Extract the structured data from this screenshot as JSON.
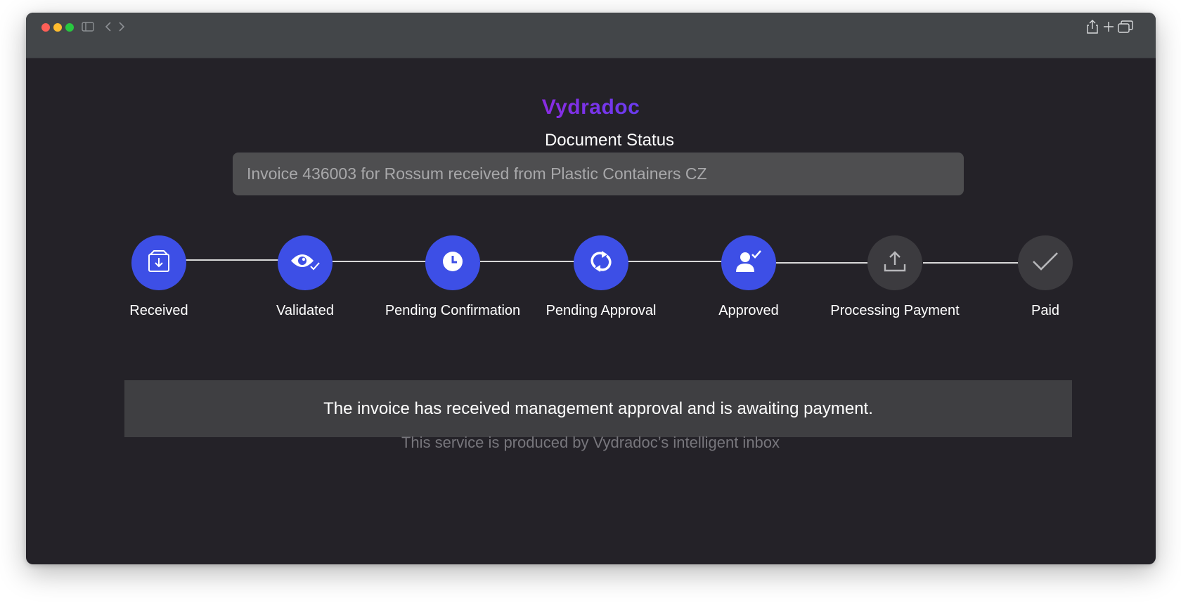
{
  "app": {
    "brand": "Vydradoc",
    "page_title": "Document Status"
  },
  "document": {
    "placeholder": "Invoice 436003 for Rossum received from Plastic Containers CZ"
  },
  "steps": [
    {
      "label": "Received",
      "icon": "inbox-download-icon",
      "state": "done"
    },
    {
      "label": "Validated",
      "icon": "eye-check-icon",
      "state": "done"
    },
    {
      "label": "Pending Confirmation",
      "icon": "clock-icon",
      "state": "done"
    },
    {
      "label": "Pending Approval",
      "icon": "refresh-icon",
      "state": "done"
    },
    {
      "label": "Approved",
      "icon": "user-check-icon",
      "state": "done"
    },
    {
      "label": "Processing Payment",
      "icon": "upload-icon",
      "state": "todo"
    },
    {
      "label": "Paid",
      "icon": "checkmark-icon",
      "state": "todo"
    }
  ],
  "status_message": "The invoice has received management approval and is awaiting payment.",
  "footer": "This service is produced by Vydradoc’s intelligent inbox",
  "colors": {
    "accent": "#3d4fe6",
    "brand_gradient_start": "#8a2be2",
    "brand_gradient_end": "#6a3cf0",
    "pending": "#3c3b3f",
    "background": "#242228"
  }
}
